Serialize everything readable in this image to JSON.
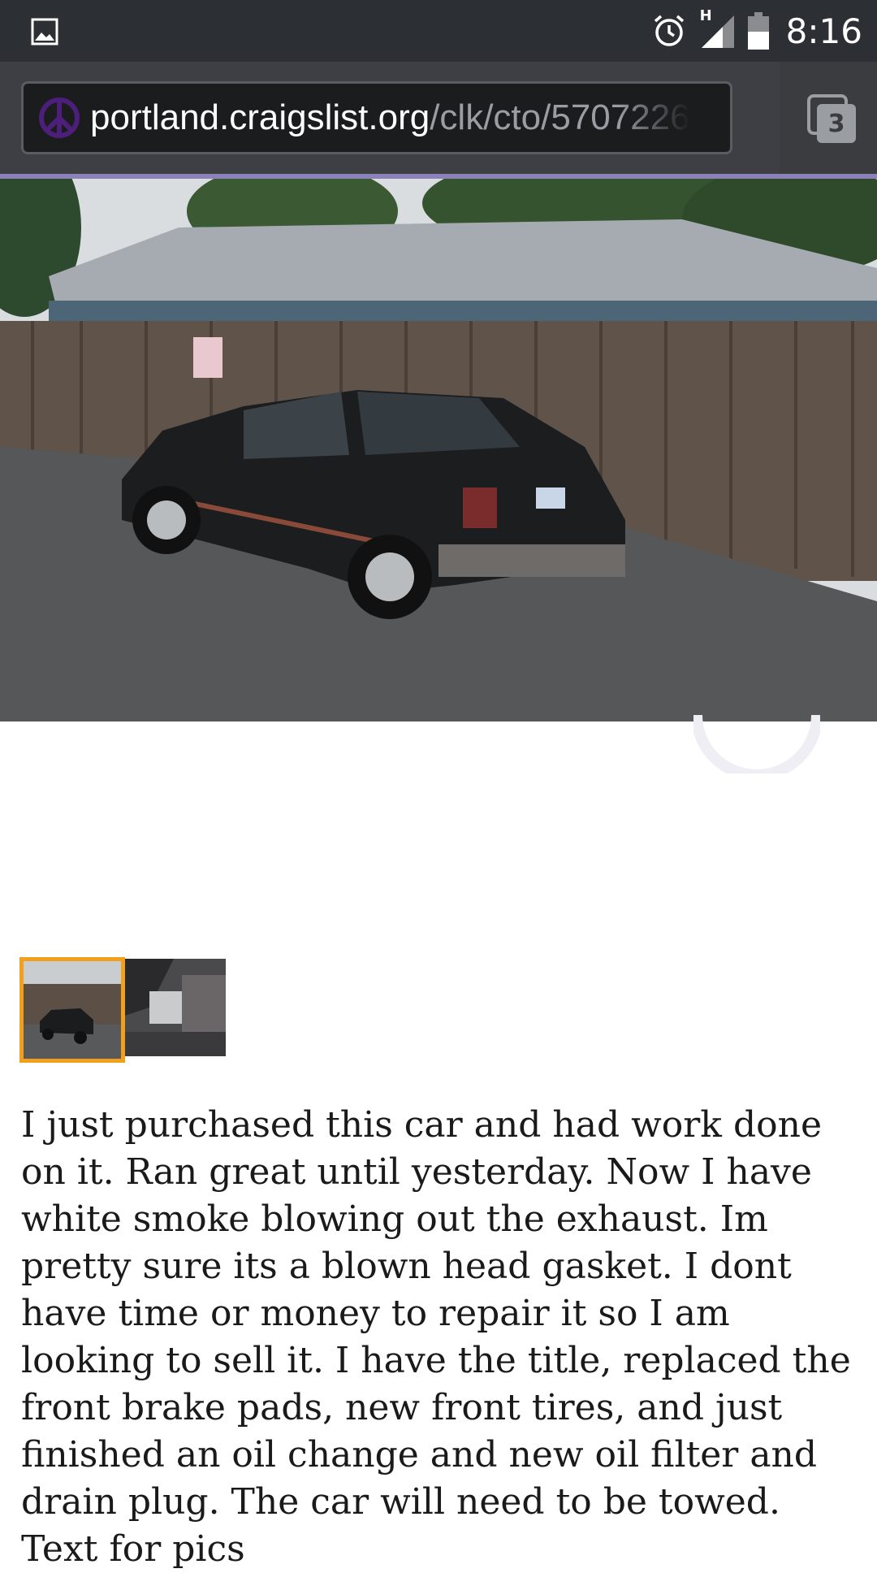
{
  "status_bar": {
    "time": "8:16",
    "network_type": "H",
    "icons": [
      "gallery-icon",
      "alarm-icon",
      "signal-icon",
      "battery-icon"
    ]
  },
  "browser": {
    "url_host": "portland.craigslist.org",
    "url_path": "/clk/cto/5707226",
    "tab_count": "3"
  },
  "listing": {
    "thumbnails": [
      "car exterior",
      "car interior"
    ],
    "selected_thumbnail": 0,
    "description": "I just purchased this car and had work done on it. Ran great until yesterday. Now I have white smoke blowing out the exhaust. Im pretty sure its a blown head gasket. I dont have time or money to repair it so I am looking to sell it. I have the title, replaced the front brake pads, new front tires, and just finished an oil change and new oil filter and drain plug. The car will need to be towed. Text for pics"
  },
  "colors": {
    "status_bar_bg": "#2c2f33",
    "accent_progress": "#8a82b8",
    "thumbnail_selected": "#f0a01c",
    "favicon": "#4b1f7a"
  }
}
